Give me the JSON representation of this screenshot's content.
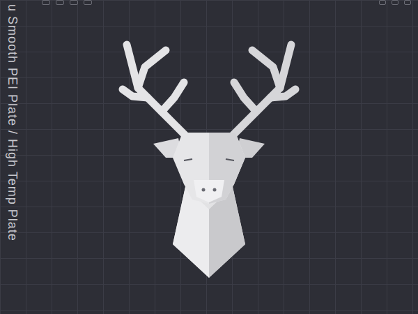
{
  "plate": {
    "label": "u Smooth PEI Plate / High Temp Plate"
  }
}
